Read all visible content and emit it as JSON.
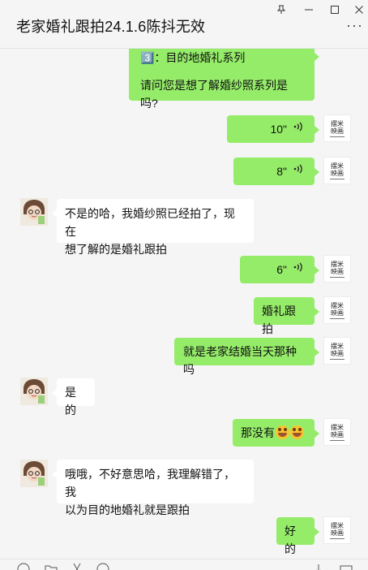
{
  "window": {
    "title": "老家婚礼跟拍24.1.6陈抖无效",
    "pin_glyph": "⊼",
    "minimize_glyph": "—",
    "maximize_glyph": "☐",
    "close_glyph": "✕",
    "more_glyph": "···"
  },
  "me_avatar": {
    "line1": "摆米",
    "line2": "映画"
  },
  "messages": [
    {
      "from": "me",
      "type": "text",
      "line1": "3️⃣：目的地婚礼系列",
      "line2": "请问您是想了解婚纱照系列是吗?"
    },
    {
      "from": "me",
      "type": "voice",
      "duration": "10\""
    },
    {
      "from": "me",
      "type": "voice",
      "duration": "8\""
    },
    {
      "from": "other",
      "type": "text",
      "line1": "不是的哈，我婚纱照已经拍了，现在",
      "line2": "想了解的是婚礼跟拍"
    },
    {
      "from": "me",
      "type": "voice",
      "duration": "6\""
    },
    {
      "from": "me",
      "type": "text",
      "text": "婚礼跟拍"
    },
    {
      "from": "me",
      "type": "text",
      "text": "就是老家结婚当天那种吗"
    },
    {
      "from": "other",
      "type": "text",
      "text": "是的"
    },
    {
      "from": "me",
      "type": "text",
      "text": "那没有",
      "emojis": [
        "grin-sweat-emoji",
        "grin-sweat-emoji"
      ]
    },
    {
      "from": "other",
      "type": "text",
      "line1": "哦哦，不好意思哈，我理解错了，我",
      "line2": "以为目的地婚礼就是跟拍"
    },
    {
      "from": "me",
      "type": "text",
      "text": "好的"
    }
  ],
  "voice_icon": "wave-voice-icon",
  "colors": {
    "my_bubble": "#95ec69",
    "other_bubble": "#ffffff",
    "background": "#f5f5f5"
  }
}
